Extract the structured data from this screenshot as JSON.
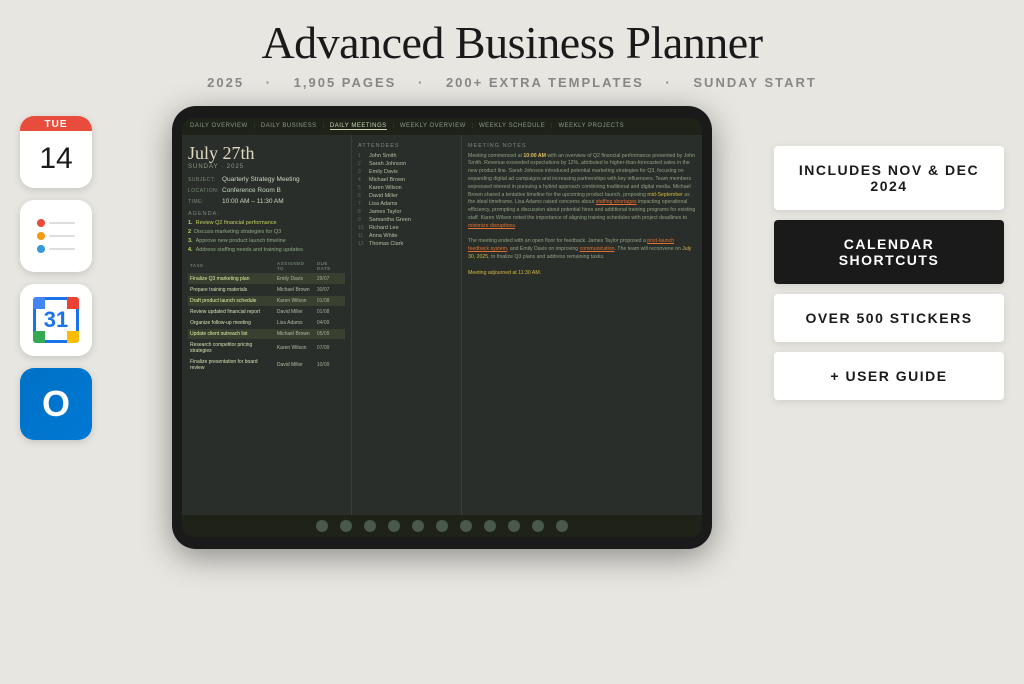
{
  "header": {
    "main_title": "Advanced Business Planner",
    "subtitle_year": "2025",
    "subtitle_pages": "1,905 PAGES",
    "subtitle_templates": "200+ EXTRA TEMPLATES",
    "subtitle_start": "SUNDAY START",
    "dot": "·"
  },
  "calendar_icon": {
    "day": "TUE",
    "number": "14"
  },
  "gcal_icon": {
    "number": "31"
  },
  "tablet": {
    "nav_items": [
      "DAILY OVERVIEW",
      "DAILY BUSINESS",
      "DAILY MEETINGS",
      "WEEKLY OVERVIEW",
      "WEEKLY SCHEDULE",
      "WEEKLY PROJECTS"
    ],
    "active_nav": "DAILY MEETINGS",
    "date": {
      "day": "July 27th",
      "sub": "SUNDAY · 2025"
    },
    "meeting": {
      "subject_label": "SUBJECT:",
      "subject_value": "Quarterly Strategy Meeting",
      "location_label": "LOCATION:",
      "location_value": "Conference Room B",
      "time_label": "TIME:",
      "time_value": "10:00 AM – 11:30 AM"
    },
    "agenda_title": "AGENDA:",
    "agenda_items": [
      {
        "num": "1.",
        "text": "Review Q2 financial performance",
        "highlight": true
      },
      {
        "num": "2",
        "text": "Discuss marketing strategies for Q3"
      },
      {
        "num": "3.",
        "text": "Approve new product launch timeline"
      },
      {
        "num": "4.",
        "text": "Address staffing needs and training updates"
      }
    ],
    "tasks_headers": [
      "TASK",
      "ASSIGNED TO",
      "DUE DATE"
    ],
    "tasks": [
      {
        "name": "Finalize Q3 marketing plan",
        "assigned": "Emily Davis",
        "date": "29/07",
        "highlight": true
      },
      {
        "name": "Prepare training materials",
        "assigned": "Michael Brown",
        "date": "30/07"
      },
      {
        "name": "Draft product launch schedule",
        "assigned": "Karen Wilson",
        "date": "01/08",
        "highlight": true
      },
      {
        "name": "Review updated financial report",
        "assigned": "David Miller",
        "date": "01/08"
      },
      {
        "name": "Organize follow-up meeting",
        "assigned": "Lisa Adams",
        "date": "04/09"
      },
      {
        "name": "Update client outreach list",
        "assigned": "Michael Brown",
        "date": "05/09",
        "highlight": true
      },
      {
        "name": "Research competitor pricing strategies",
        "assigned": "Karen Wilson",
        "date": "07/09"
      },
      {
        "name": "Finalize presentation for board review",
        "assigned": "David Miller",
        "date": "10/09"
      }
    ],
    "attendees_title": "ATTENDEES",
    "attendees": [
      {
        "num": "1",
        "name": "John Smith"
      },
      {
        "num": "2",
        "name": "Sarah Johnson"
      },
      {
        "num": "3",
        "name": "Emily Davis"
      },
      {
        "num": "4",
        "name": "Michael Brown"
      },
      {
        "num": "5",
        "name": "Karen Wilson"
      },
      {
        "num": "6",
        "name": "David Miller"
      },
      {
        "num": "7",
        "name": "Lisa Adams"
      },
      {
        "num": "8",
        "name": "James Taylor"
      },
      {
        "num": "9",
        "name": "Samantha Green"
      },
      {
        "num": "10",
        "name": "Richard Lee"
      },
      {
        "num": "11",
        "name": "Anna White"
      },
      {
        "num": "12",
        "name": "Thomas Clark"
      }
    ],
    "notes_title": "MEETING NOTES",
    "notes_para1": "Meeting commenced at 10:00 AM with an overview of Q2 financial performance presented by John Smith. Revenue exceeded expectations by 12%, attributed to higher-than-forecasted sales in the new product line. Sarah Johnson introduced potential marketing strategies for Q3, focusing on expanding digital ad campaigns and increasing partnerships with key influencers. Team members expressed interest in pursuing a hybrid approach combining traditional and digital media. Michael Brown shared a tentative timeline for the upcoming product launch, proposing mid-September as the ideal timeframe. Lisa Adams raised concerns about staffing shortages impacting operational efficiency, prompting a discussion about potential hires and additional training programs for existing staff. Karen Wilson noted the importance of aligning training schedules with project deadlines to minimize disruptions.",
    "notes_para2": "The meeting ended with an open floor for feedback. James Taylor proposed a post-launch feedback system, and Emily Davis on improving communication. The team will reconvene on July 30, 2025, to finalize Q3 plans and address remaining tasks.",
    "notes_footer": "Meeting adjourned at 11:30 AM."
  },
  "badges": [
    {
      "text": "INCLUDES NOV & DEC 2024",
      "dark": false
    },
    {
      "text": "CALENDAR SHORTCUTS",
      "dark": true
    },
    {
      "text": "OVER 500 STICKERS",
      "dark": false
    },
    {
      "text": "+ USER GUIDE",
      "dark": false
    }
  ]
}
